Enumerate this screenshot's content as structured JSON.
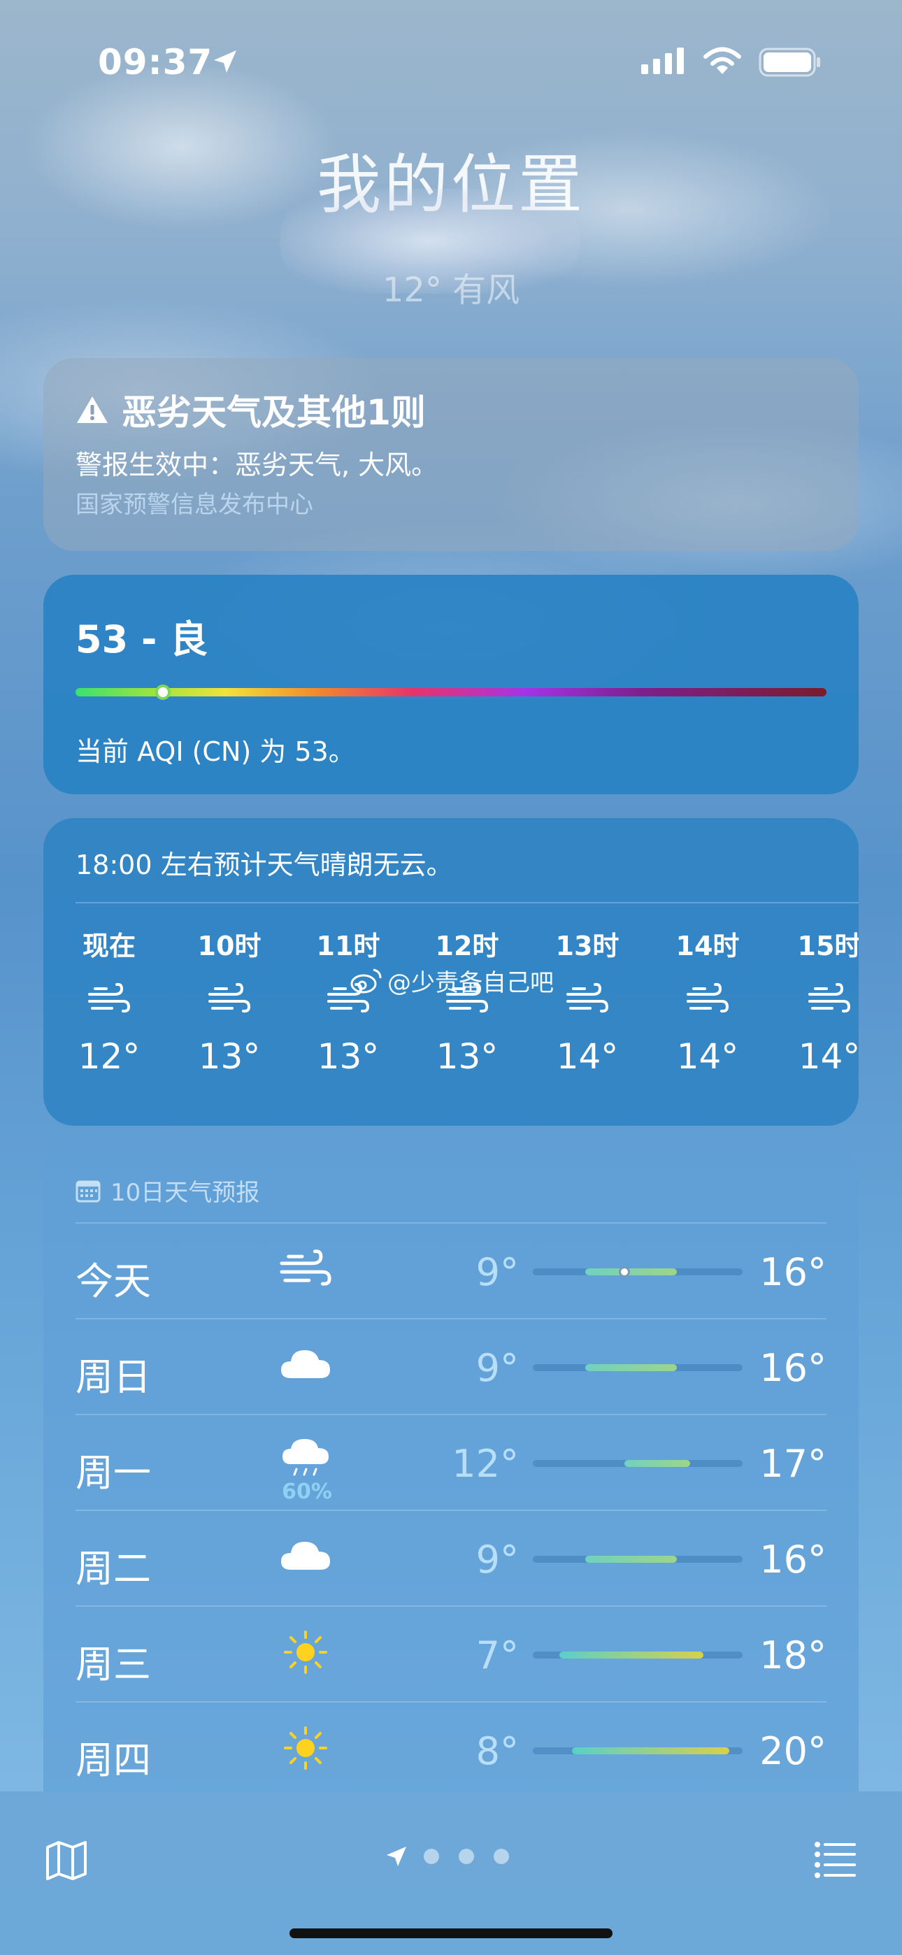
{
  "status_bar": {
    "time": "09:37"
  },
  "header": {
    "location": "我的位置",
    "condition": "12° 有风"
  },
  "alert": {
    "title": "恶劣天气及其他1则",
    "body": "警报生效中：恶劣天气, 大风。",
    "source": "国家预警信息发布中心"
  },
  "aqi": {
    "value_label": "53 - 良",
    "description": "当前 AQI (CN) 为 53。",
    "value": 53
  },
  "hourly": {
    "summary": "18:00 左右预计天气晴朗无云。",
    "items": [
      {
        "label": "现在",
        "icon": "wind-icon",
        "temp": "12°"
      },
      {
        "label": "10时",
        "icon": "wind-icon",
        "temp": "13°"
      },
      {
        "label": "11时",
        "icon": "wind-icon",
        "temp": "13°"
      },
      {
        "label": "12时",
        "icon": "wind-icon",
        "temp": "13°"
      },
      {
        "label": "13时",
        "icon": "wind-icon",
        "temp": "14°"
      },
      {
        "label": "14时",
        "icon": "wind-icon",
        "temp": "14°"
      },
      {
        "label": "15时",
        "icon": "wind-icon",
        "temp": "14°"
      }
    ]
  },
  "watermark": "@少责备自己吧",
  "forecast": {
    "header": "10日天气预报",
    "days": [
      {
        "day": "今天",
        "icon": "wind-icon",
        "pop": "",
        "low": "9°",
        "high": "16°"
      },
      {
        "day": "周日",
        "icon": "cloud-icon",
        "pop": "",
        "low": "9°",
        "high": "16°"
      },
      {
        "day": "周一",
        "icon": "rain-cloud-icon",
        "pop": "60%",
        "low": "12°",
        "high": "17°"
      },
      {
        "day": "周二",
        "icon": "cloud-icon",
        "pop": "",
        "low": "9°",
        "high": "16°"
      },
      {
        "day": "周三",
        "icon": "sun-icon",
        "pop": "",
        "low": "7°",
        "high": "18°"
      },
      {
        "day": "周四",
        "icon": "sun-icon",
        "pop": "",
        "low": "8°",
        "high": "20°"
      }
    ]
  },
  "colors": {
    "aqi_indicator": "#7dd858",
    "forecast_bar_cool": "#5ad0c8",
    "forecast_bar_warm": "#d8d04a",
    "pop_text": "#8fd0f5"
  }
}
